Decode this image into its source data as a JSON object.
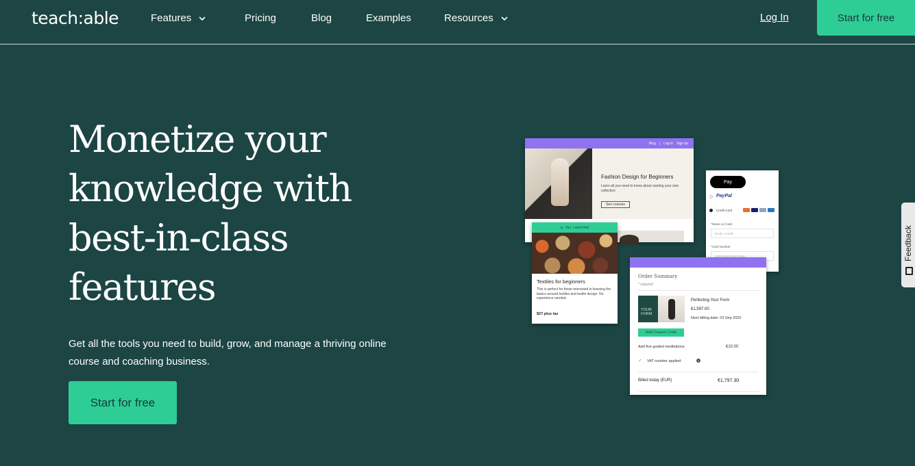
{
  "nav": {
    "logo": "teach:able",
    "items": [
      {
        "label": "Features",
        "has_dropdown": true
      },
      {
        "label": "Pricing",
        "has_dropdown": false
      },
      {
        "label": "Blog",
        "has_dropdown": false
      },
      {
        "label": "Examples",
        "has_dropdown": false
      },
      {
        "label": "Resources",
        "has_dropdown": true
      }
    ],
    "login": "Log In",
    "cta": "Start for free"
  },
  "hero": {
    "title": "Monetize your knowledge with best-in-class features",
    "subtitle": "Get all the tools you need to build, grow, and manage a thriving online course and coaching business.",
    "cta": "Start for free"
  },
  "mockups": {
    "site": {
      "nav_links": [
        "Blog",
        "|",
        "Log In",
        "Sign up"
      ],
      "title": "Fashion Design for Beginners",
      "desc": "Learn all you need to know about starting your own collection",
      "button": "See courses"
    },
    "course": {
      "bar_label": "Yes, I want this!",
      "title": "Textiles for beginners",
      "desc": "This is perfect for those interested in learning the basics around textiles and textile design. No experience needed.",
      "price": "$27 plus tax"
    },
    "payment": {
      "apple_pay": "Pay",
      "paypal": "PayPal",
      "credit_card": "Credit Card",
      "name_label": "*Name on Card",
      "name_placeholder": "Emily J Smith",
      "number_label": "*Card Number",
      "number_placeholder": "1234 1234 1234 1234"
    },
    "order": {
      "title": "Order Summary",
      "required": "* required",
      "thumb_text": "YOUR FORM",
      "product": "Perfecting Your Form",
      "price": "€1,597.00",
      "billing": "Next billing date: 03 Sep 2020",
      "coupon": "Add Coupon Code",
      "addon_label": "Add five guided meditations",
      "addon_price": "€10.00",
      "vat": "VAT number applied",
      "billed_label": "Billed today (EUR)",
      "billed_price": "€1,797.30"
    }
  },
  "feedback": {
    "label": "Feedback"
  },
  "colors": {
    "background": "#1c4543",
    "accent": "#2fcd96",
    "purple": "#8e72f0"
  }
}
